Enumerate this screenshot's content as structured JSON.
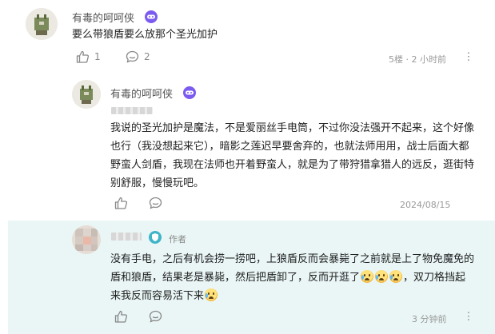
{
  "comment": {
    "username": "有毒的呵呵侠",
    "text": "要么带狼盾要么放那个圣光加护",
    "like_count": "1",
    "reply_count": "2",
    "meta": "5楼 · 2 小时前"
  },
  "reply1": {
    "username": "有毒的呵呵侠",
    "text": "我说的圣光加护是魔法，不是爱丽丝手电筒，不过你没法强开不起来，这个好像也行（我没想起来它），暗影之莲迟早要舍弃的，也就法师用用，战士后面大都野蛮人剑盾，我现在法师也开着野蛮人，就是为了带狩猎拿猎人的远反，逛街特别舒服，慢慢玩吧。",
    "date": "2024/08/15"
  },
  "reply2": {
    "author_tag": "作者",
    "text_part1": "没有手电，之后有机会捞一捞吧，上狼盾反而会暴毙了之前就是上了物免魔免的盾和狼盾，结果老是暴毙，然后把盾卸了，反而开逛了",
    "text_part2": "，双刀格挡起来我反而容易活下来",
    "time": "3 分钟前"
  },
  "colors": {
    "badge_purple": "#7c5cf0",
    "author_badge_teal": "#40b4c8",
    "reply_panel_bg": "#e9f6f5"
  },
  "icons": [
    "thumbs-up-icon",
    "comment-icon",
    "more-dots-icon",
    "game-badge-icon",
    "author-shield-icon",
    "crying-emoji-icon"
  ]
}
